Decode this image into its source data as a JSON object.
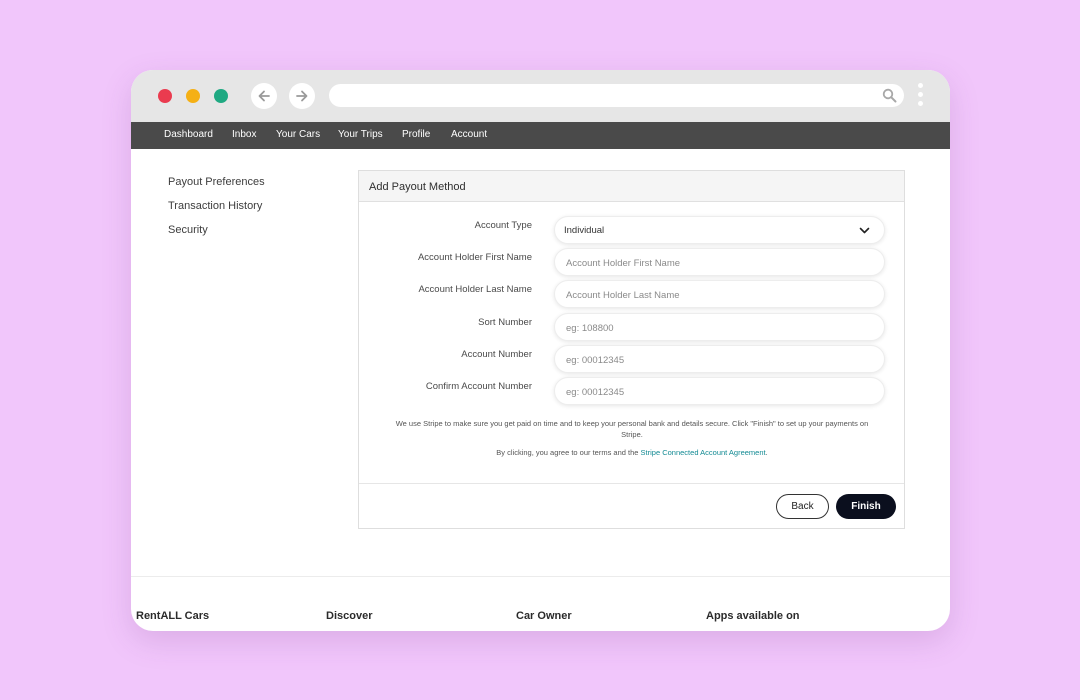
{
  "browser": {
    "url": ""
  },
  "topnav": {
    "items": [
      "Dashboard",
      "Inbox",
      "Your Cars",
      "Your Trips",
      "Profile",
      "Account"
    ]
  },
  "sidebar": {
    "items": [
      "Payout Preferences",
      "Transaction History",
      "Security"
    ]
  },
  "form": {
    "title": "Add Payout Method",
    "account_type": {
      "label": "Account Type",
      "value": "Individual"
    },
    "first_name": {
      "label": "Account Holder First Name",
      "placeholder": "Account Holder First Name"
    },
    "last_name": {
      "label": "Account Holder Last Name",
      "placeholder": "Account Holder Last Name"
    },
    "sort_number": {
      "label": "Sort Number",
      "placeholder": "eg: 108800"
    },
    "account_number": {
      "label": "Account Number",
      "placeholder": "eg: 00012345"
    },
    "confirm_account_number": {
      "label": "Confirm Account Number",
      "placeholder": "eg: 00012345"
    },
    "note_line1": "We use Stripe to make sure you get paid on time and to keep your personal bank and details secure. Click \"Finish\" to set up your payments on Stripe.",
    "note_line2_prefix": "By clicking, you agree to our terms and the ",
    "note_line2_link": "Stripe Connected Account Agreement",
    "note_line2_suffix": ".",
    "back_label": "Back",
    "finish_label": "Finish"
  },
  "footer": {
    "columns": [
      "RentALL Cars",
      "Discover",
      "Car Owner",
      "Apps available on"
    ]
  },
  "colors": {
    "background": "#f1c6fb",
    "nav_bar": "#4a4a4a",
    "link": "#128a93",
    "primary_button": "#0b0f1e",
    "traffic_red": "#ea3b4f",
    "traffic_yellow": "#f5b015",
    "traffic_green": "#1fa982"
  }
}
